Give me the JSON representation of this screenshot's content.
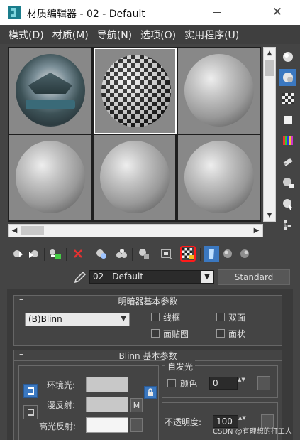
{
  "window": {
    "title": "材质编辑器 - 02 - Default",
    "minimize_icon": "minimize-icon",
    "maximize_icon": "maximize-icon",
    "close_glyph": "✕"
  },
  "menu": {
    "items": [
      {
        "label": "模式(D)"
      },
      {
        "label": "材质(M)"
      },
      {
        "label": "导航(N)"
      },
      {
        "label": "选项(O)"
      },
      {
        "label": "实用程序(U)"
      }
    ]
  },
  "slots": {
    "active_index": 1,
    "items": [
      {
        "kind": "environment-sphere"
      },
      {
        "kind": "checker-sphere"
      },
      {
        "kind": "gray-sphere"
      },
      {
        "kind": "gray-sphere"
      },
      {
        "kind": "gray-sphere"
      },
      {
        "kind": "gray-sphere"
      }
    ]
  },
  "scroll": {
    "up_glyph": "▲",
    "down_glyph": "▼",
    "left_glyph": "◀",
    "right_glyph": "▶"
  },
  "side_tools": [
    "sample-type-sphere-icon",
    "backlight-icon",
    "background-checker-icon",
    "sample-uv-tiling-icon",
    "video-color-check-icon",
    "make-preview-icon",
    "options-icon",
    "select-by-material-icon",
    "material-map-navigator-icon"
  ],
  "toolbar": [
    "get-material-icon",
    "put-material-to-scene-icon",
    "assign-material-to-selection-icon",
    "reset-map-icon",
    "make-material-copy-icon",
    "make-unique-icon",
    "put-to-library-icon",
    "material-id-channel-icon",
    "show-shaded-material-in-viewport-icon",
    "show-end-result-icon",
    "go-to-parent-icon",
    "go-forward-to-sibling-icon"
  ],
  "material": {
    "name": "02 - Default",
    "dropdown_glyph": "▼",
    "type_button": "Standard"
  },
  "shader_basic": {
    "header": "明暗器基本参数",
    "collapse": "–",
    "shader_value": "(B)Blinn",
    "options": {
      "wire": "线框",
      "two_sided": "双面",
      "face_map": "面贴图",
      "faceted": "面状"
    }
  },
  "blinn_basic": {
    "header": "Blinn 基本参数",
    "collapse": "–",
    "ambient_label": "环境光:",
    "diffuse_label": "漫反射:",
    "specular_label": "高光反射:",
    "map_button": "M",
    "self_illum_title": "自发光",
    "color_label": "颜色",
    "self_illum_value": "0",
    "opacity_label": "不透明度:",
    "opacity_value": "100",
    "spin_glyph": "▲▼",
    "colors": {
      "ambient": "#c8c8c8",
      "diffuse": "#c8c8c8",
      "specular": "#f5f5f5",
      "accent": "#3b78c0"
    }
  },
  "watermark": "CSDN @有理想的打工人"
}
